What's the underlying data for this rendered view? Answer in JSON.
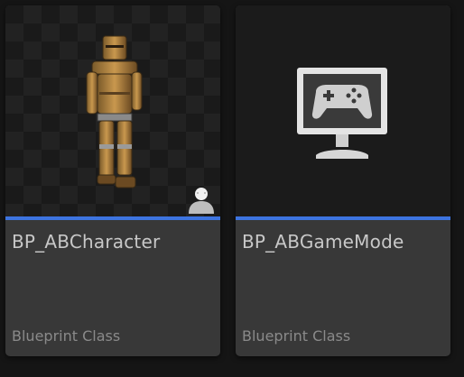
{
  "accent_color": "#3d74e0",
  "assets": [
    {
      "name": "BP_ABCharacter",
      "type": "Blueprint Class",
      "thumbnail": "armored-character-thumbnail",
      "badge_icon": "character-class-icon"
    },
    {
      "name": "BP_ABGameMode",
      "type": "Blueprint Class",
      "thumbnail": "game-mode-icon"
    }
  ]
}
